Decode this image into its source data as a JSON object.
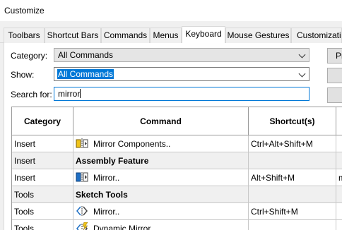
{
  "window": {
    "title": "Customize"
  },
  "tabs": [
    {
      "label": "Toolbars",
      "active": false
    },
    {
      "label": "Shortcut Bars",
      "active": false
    },
    {
      "label": "Commands",
      "active": false
    },
    {
      "label": "Menus",
      "active": false
    },
    {
      "label": "Keyboard",
      "active": true
    },
    {
      "label": "Mouse Gestures",
      "active": false
    },
    {
      "label": "Customization",
      "active": false
    }
  ],
  "filters": {
    "category_label": "Category:",
    "category_value": "All Commands",
    "show_label": "Show:",
    "show_value": "All Commands",
    "search_label": "Search for:",
    "search_value": "mirror"
  },
  "right_buttons": [
    {
      "label": "Pr"
    },
    {
      "label": ""
    },
    {
      "label": ""
    }
  ],
  "table": {
    "headers": {
      "category": "Category",
      "command": "Command",
      "shortcuts": "Shortcut(s)"
    },
    "rows": [
      {
        "category": "Insert",
        "command": "Mirror Components..",
        "shortcut": "Ctrl+Alt+Shift+M",
        "extra": "",
        "icon": "mirror-components-icon"
      },
      {
        "category": "Insert",
        "command": "Assembly Feature",
        "shortcut": "",
        "extra": "",
        "group": true
      },
      {
        "category": "Insert",
        "command": "Mirror..",
        "shortcut": "Alt+Shift+M",
        "extra": "m",
        "icon": "mirror-feature-icon"
      },
      {
        "category": "Tools",
        "command": "Sketch Tools",
        "shortcut": "",
        "extra": "",
        "group": true
      },
      {
        "category": "Tools",
        "command": "Mirror..",
        "shortcut": "Ctrl+Shift+M",
        "extra": "",
        "icon": "mirror-sketch-icon"
      },
      {
        "category": "Tools",
        "command": "Dynamic Mirror..",
        "shortcut": "",
        "extra": "",
        "icon": "dynamic-mirror-icon"
      }
    ]
  },
  "colors": {
    "selection": "#0078d7",
    "icon_blue": "#1e6fc4",
    "icon_yellow": "#f0c419"
  }
}
